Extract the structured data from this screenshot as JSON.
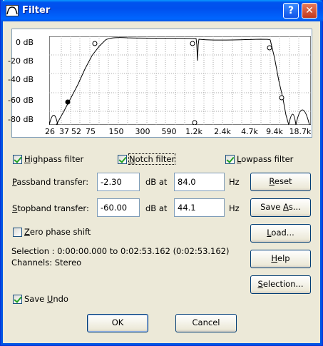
{
  "window": {
    "title": "Filter",
    "help_glyph": "?",
    "close_glyph": "✕"
  },
  "graph": {
    "y_ticks": [
      "0 dB",
      "-20 dB",
      "-40 dB",
      "-60 dB",
      "-80 dB"
    ],
    "x_ticks": [
      "26",
      "37",
      "52",
      "75",
      "150",
      "300",
      "590",
      "1.2k",
      "2.4k",
      "4.7k",
      "9.4k",
      "18.7k"
    ]
  },
  "checkboxes": {
    "highpass": {
      "pre": "",
      "ul": "H",
      "post": "ighpass filter",
      "checked": true
    },
    "notch": {
      "pre": "",
      "ul": "N",
      "post": "otch filter",
      "checked": true
    },
    "lowpass": {
      "pre": "",
      "ul": "L",
      "post": "owpass filter",
      "checked": true
    },
    "zero_phase": {
      "pre": "",
      "ul": "Z",
      "post": "ero phase shift",
      "checked": false
    },
    "save_undo": {
      "pre": "Save ",
      "ul": "U",
      "post": "ndo",
      "checked": true
    }
  },
  "passband": {
    "label_ul": "P",
    "label_rest": "assband transfer:",
    "db_value": "-2.30",
    "at_label": "dB at",
    "hz_value": "84.0",
    "hz_label": "Hz"
  },
  "stopband": {
    "label_ul": "S",
    "label_rest": "topband transfer:",
    "db_value": "-60.00",
    "at_label": "dB at",
    "hz_value": "44.1",
    "hz_label": "Hz"
  },
  "info": {
    "selection": "Selection : 0:00:00.000 to 0:02:53.162 (0:02:53.162)",
    "channels": "Channels: Stereo"
  },
  "buttons": {
    "reset": {
      "ul": "R",
      "rest": "eset"
    },
    "save_as": {
      "pre": "Save ",
      "ul": "A",
      "rest": "s..."
    },
    "load": {
      "ul": "L",
      "rest": "oad..."
    },
    "help": {
      "ul": "H",
      "rest": "elp"
    },
    "selection": {
      "ul": "S",
      "rest": "election..."
    },
    "ok": "OK",
    "cancel": "Cancel"
  }
}
